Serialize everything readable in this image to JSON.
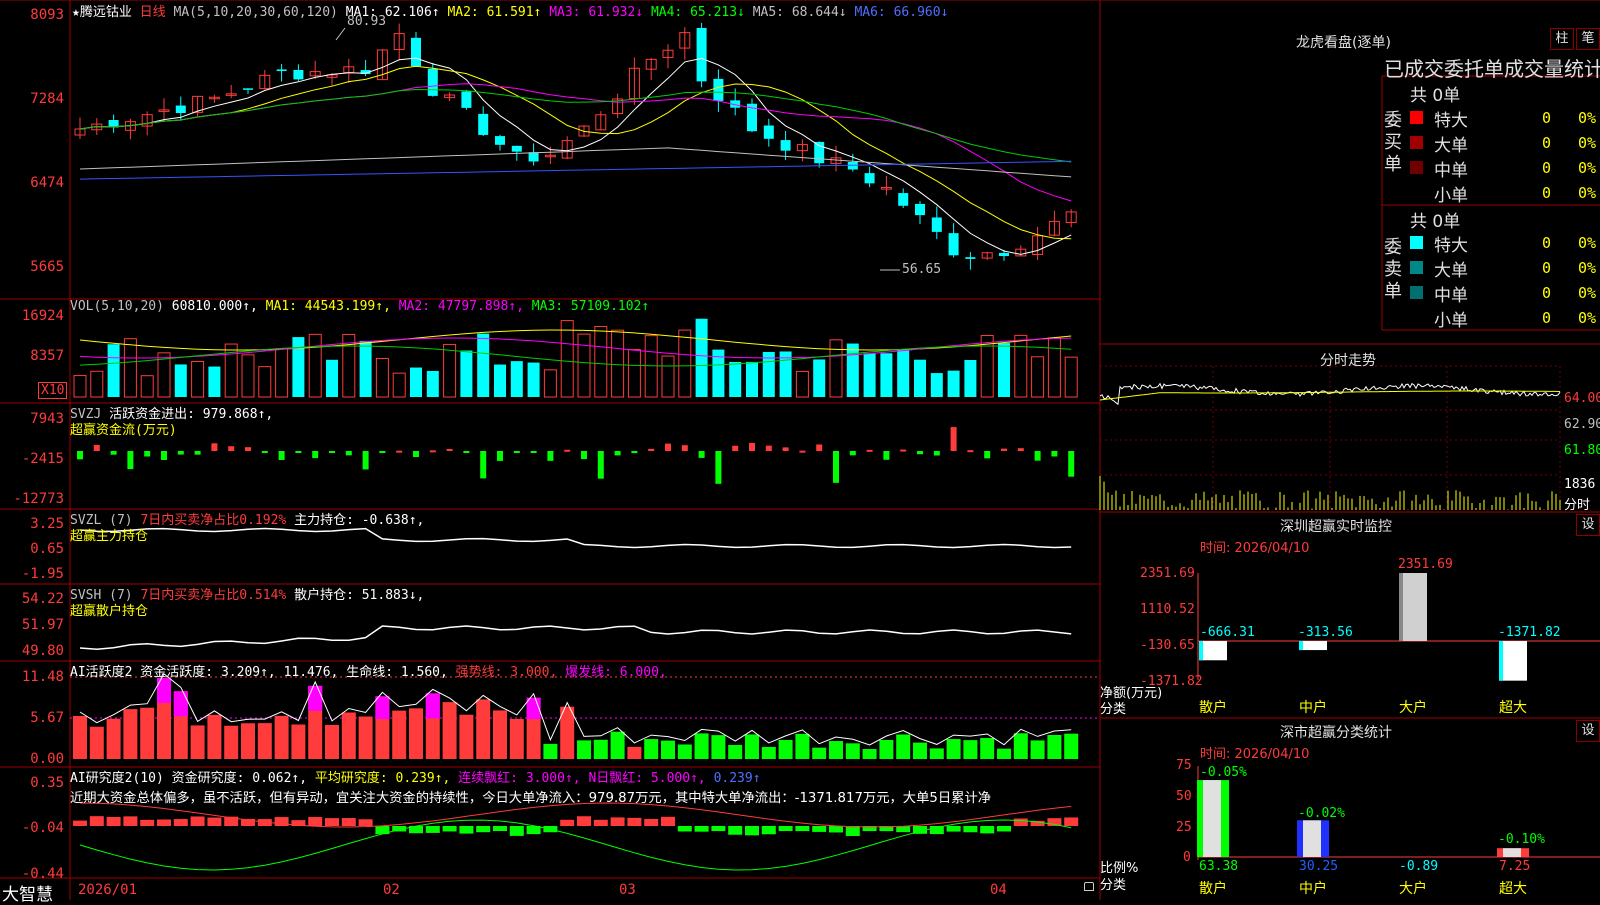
{
  "colors": {
    "up": "#ff3b3b",
    "down": "#00ffff",
    "border": "#a00000",
    "ma1": "#ffffff",
    "ma2": "#ffff00",
    "ma3": "#ff00ff",
    "ma4": "#00cc00",
    "ma5": "#c0c0c0",
    "ma6": "#3355ff"
  },
  "kline": {
    "stock_name": "★腾远钴业",
    "period": "日线",
    "ma_params": "MA(5,10,20,30,60,120)",
    "ma1": "MA1: 62.106↑",
    "ma2": "MA2: 61.591↑",
    "ma3": "MA3: 61.932↓",
    "ma4": "MA4: 65.213↓",
    "ma5": "MA5: 68.644↓",
    "ma6": "MA6: 66.960↓",
    "high_mark": "80.93",
    "low_mark": "56.65",
    "y_ticks": [
      "8093",
      "7284",
      "6474",
      "5665"
    ]
  },
  "vol": {
    "params": "VOL(5,10,20)",
    "value": "60810.000↑,",
    "ma1": "MA1: 44543.199↑,",
    "ma2": "MA2: 47797.898↑,",
    "ma3": "MA3: 57109.102↑",
    "y_ticks": [
      "16924",
      "8357"
    ],
    "unit": "X10"
  },
  "svzj": {
    "title": "SVZJ",
    "label": "活跃资金进出: 979.868↑,",
    "subtitle": "超赢资金流(万元)",
    "y_ticks": [
      "7943",
      "-2415",
      "-12773"
    ]
  },
  "svzl": {
    "title": "SVZL (7)",
    "label": "7日内买卖净占比0.192%",
    "label2": "主力持仓: -0.638↑,",
    "subtitle": "超赢主力持仓",
    "y_ticks": [
      "3.25",
      "0.65",
      "-1.95"
    ]
  },
  "svsh": {
    "title": "SVSH (7)",
    "label": "7日内买卖净占比0.514%",
    "label2": "散户持仓: 51.883↓,",
    "subtitle": "超赢散户持仓",
    "y_ticks": [
      "54.22",
      "51.97",
      "49.80"
    ]
  },
  "ai_active": {
    "title": "AI活跃度2 资金活跃度: 3.209↑,",
    "v2": "11.476,",
    "life": "生命线: 1.560,",
    "strong": "强势线: 3.000,",
    "burst": "爆发线: 6.000,",
    "y_ticks": [
      "11.48",
      "5.67",
      "0.00"
    ]
  },
  "ai_research": {
    "title": "AI研究度2(10) 资金研究度: 0.062↑,",
    "avg": "平均研究度: 0.239↑,",
    "streak": "连续飘红: 3.000↑,",
    "nday": "N日飘红: 5.000↑,",
    "last": "0.239↑",
    "comment": "近期大资金总体偏多，虽不活跃，但有异动，宜关注大资金的持续性，今日大单净流入：979.87万元，其中特大单净流出：-1371.817万元，大单5日累计净",
    "y_ticks": [
      "0.35",
      "-0.04",
      "-0.44"
    ]
  },
  "x_axis": {
    "labels": [
      "2026/01",
      "02",
      "03",
      "04"
    ],
    "brand": "大智慧"
  },
  "orders": {
    "title": "龙虎看盘(逐单)",
    "btn_bar": "柱",
    "btn_pen": "笔",
    "subtitle": "已成交委托单成交量统计",
    "buy_side": "委买单",
    "sell_side": "委卖单",
    "buy_total": "共 0单",
    "sell_total": "共 0单",
    "buy_rows": [
      {
        "name": "特大",
        "count": "0",
        "pct": "0%",
        "color": "#ff0000"
      },
      {
        "name": "大单",
        "count": "0",
        "pct": "0%",
        "color": "#a00000"
      },
      {
        "name": "中单",
        "count": "0",
        "pct": "0%",
        "color": "#700000"
      },
      {
        "name": "小单",
        "count": "0",
        "pct": "0%",
        "color": "#000000"
      }
    ],
    "sell_rows": [
      {
        "name": "特大",
        "count": "0",
        "pct": "0%",
        "color": "#00ffff"
      },
      {
        "name": "大单",
        "count": "0",
        "pct": "0%",
        "color": "#008888"
      },
      {
        "name": "中单",
        "count": "0",
        "pct": "0%",
        "color": "#006f6f"
      },
      {
        "name": "小单",
        "count": "0",
        "pct": "0%",
        "color": "#000000"
      }
    ]
  },
  "intraday": {
    "title": "分时走势",
    "y_ticks": [
      "64.00",
      "62.90",
      "61.80"
    ],
    "vol_label": "1836",
    "vol_unit": "分时"
  },
  "sz_monitor": {
    "title": "深圳超赢实时监控",
    "btn": "设",
    "time": "时间: 2026/04/10",
    "y_ticks": [
      "2351.69",
      "1110.52",
      "-130.65",
      "-1371.82"
    ],
    "ylabel": "净额(万元)",
    "xlabel": "分类",
    "categories": [
      "散户",
      "中户",
      "大户",
      "超大"
    ],
    "values": [
      "-666.31",
      "-313.56",
      "2351.69",
      "-1371.82"
    ]
  },
  "sz_class": {
    "title": "深市超赢分类统计",
    "btn": "设",
    "time": "时间: 2026/04/10",
    "y_ticks": [
      "75",
      "50",
      "25",
      "0"
    ],
    "ylabel": "比例%",
    "xlabel": "分类",
    "categories": [
      "散户",
      "中户",
      "大户",
      "超大"
    ],
    "top_values": [
      "-0.05%",
      "-0.02%",
      "",
      "-0.10%"
    ],
    "bottom_values": [
      "63.38",
      "30.25",
      "-0.89",
      "7.25"
    ]
  },
  "chart_data": [
    {
      "type": "bar",
      "title": "深圳超赢实时监控",
      "categories": [
        "散户",
        "中户",
        "大户",
        "超大"
      ],
      "values": [
        -666.31,
        -313.56,
        2351.69,
        -1371.82
      ],
      "ylabel": "净额(万元)",
      "ylim": [
        -1371.82,
        2351.69
      ]
    },
    {
      "type": "bar",
      "title": "深市超赢分类统计",
      "categories": [
        "散户",
        "中户",
        "大户",
        "超大"
      ],
      "values": [
        63.38,
        30.25,
        -0.89,
        7.25
      ],
      "ylabel": "比例%",
      "ylim": [
        0,
        75
      ]
    }
  ]
}
